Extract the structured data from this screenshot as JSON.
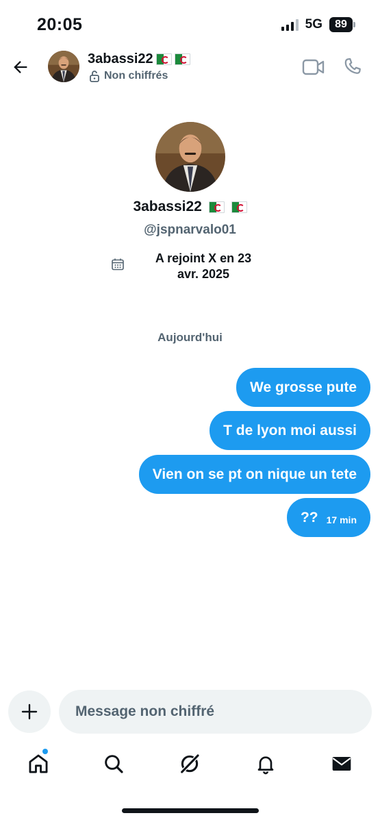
{
  "status_bar": {
    "time": "20:05",
    "network": "5G",
    "battery": "89"
  },
  "header": {
    "name": "3abassi22",
    "encryption_status": "Non chiffrés"
  },
  "profile": {
    "name": "3abassi22",
    "handle": "@jspnarvalo01",
    "joined_line1": "A rejoint X en 23",
    "joined_line2": "avr. 2025"
  },
  "conversation": {
    "day_label": "Aujourd'hui",
    "messages": [
      {
        "text": "We grosse pute",
        "sent": true
      },
      {
        "text": "T de lyon moi aussi",
        "sent": true
      },
      {
        "text": "Vien on se pt on nique un tete",
        "sent": true
      },
      {
        "text": "??",
        "sent": true,
        "time": "17 min"
      }
    ]
  },
  "composer": {
    "placeholder": "Message non chiffré"
  },
  "icons": {
    "back": "arrow-left-icon",
    "lock": "unlock-icon",
    "video": "video-camera-icon",
    "call": "phone-icon",
    "calendar": "calendar-icon",
    "plus": "plus-icon",
    "home": "home-icon",
    "search": "search-icon",
    "grok": "grok-icon",
    "notifications": "bell-icon",
    "messages": "envelope-icon"
  },
  "colors": {
    "accent": "#1d9bf0",
    "text": "#0f1419",
    "secondary": "#536471",
    "input_bg": "#eff3f4"
  }
}
